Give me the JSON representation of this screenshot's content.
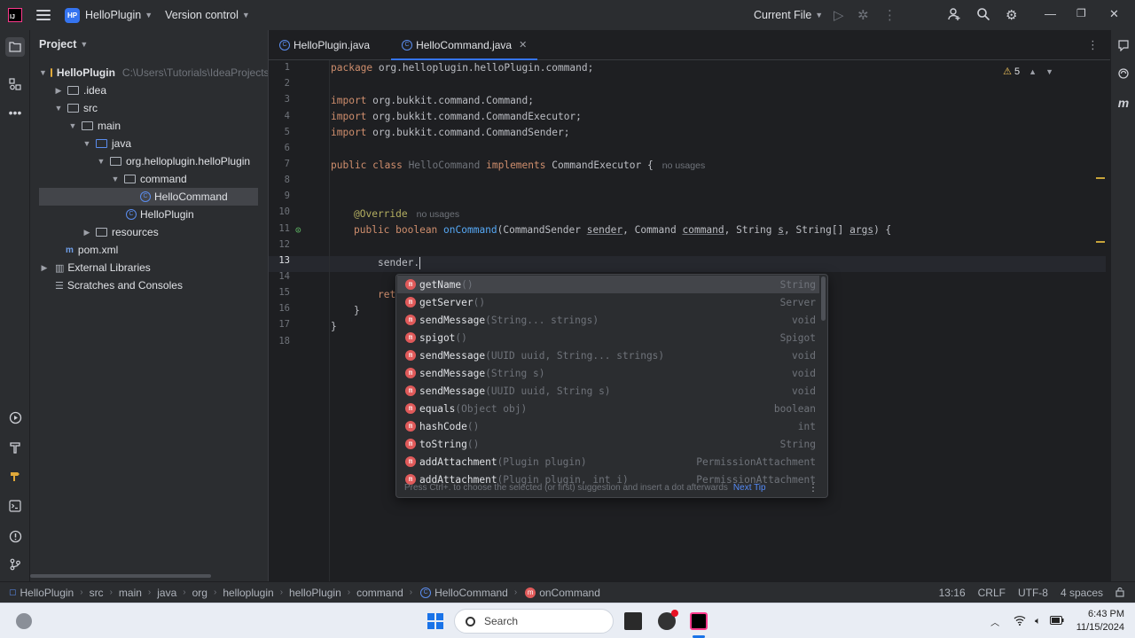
{
  "titlebar": {
    "project_badge": "HP",
    "project_name": "HelloPlugin",
    "vcs": "Version control",
    "run_config": "Current File"
  },
  "project_panel": {
    "title": "Project",
    "tree": [
      {
        "label": "HelloPlugin",
        "extra": "C:\\Users\\Tutorials\\IdeaProjects",
        "icon": "module-folder-icon",
        "expanded": true
      },
      {
        "label": ".idea",
        "icon": "folder-icon",
        "expanded": false
      },
      {
        "label": "src",
        "icon": "folder-icon",
        "expanded": true
      },
      {
        "label": "main",
        "icon": "folder-icon",
        "expanded": true
      },
      {
        "label": "java",
        "icon": "source-folder-icon",
        "expanded": true
      },
      {
        "label": "org.helloplugin.helloPlugin",
        "icon": "package-icon",
        "expanded": true
      },
      {
        "label": "command",
        "icon": "package-icon",
        "expanded": true
      },
      {
        "label": "HelloCommand",
        "icon": "class-icon",
        "selected": true
      },
      {
        "label": "HelloPlugin",
        "icon": "class-icon"
      },
      {
        "label": "resources",
        "icon": "resources-folder-icon",
        "expanded": false
      },
      {
        "label": "pom.xml",
        "icon": "maven-icon"
      },
      {
        "label": "External Libraries",
        "icon": "library-icon",
        "expanded": false
      },
      {
        "label": "Scratches and Consoles",
        "icon": "scratches-icon"
      }
    ]
  },
  "editor": {
    "tabs": [
      {
        "label": "HelloPlugin.java",
        "active": false
      },
      {
        "label": "HelloCommand.java",
        "active": true
      }
    ],
    "warnings_count": "5",
    "line_numbers": [
      "1",
      "2",
      "3",
      "4",
      "5",
      "6",
      "7",
      "8",
      "9",
      "10",
      "11",
      "12",
      "13",
      "14",
      "15",
      "16",
      "17",
      "18"
    ],
    "current_line": "13",
    "code": {
      "l1_kw": "package",
      "l1_rest": " org.helloplugin.helloPlugin.command;",
      "l3_kw": "import",
      "l3_rest": " org.bukkit.command.Command;",
      "l4_kw": "import",
      "l4_rest": " org.bukkit.command.CommandExecutor;",
      "l5_kw": "import",
      "l5_rest": " org.bukkit.command.CommandSender;",
      "l7_kw": "public class",
      "l7_name": " HelloCommand ",
      "l7_impl": "implements",
      "l7_rest": " CommandExecutor {",
      "l7_hint": "no usages",
      "l10_ann": "@Override",
      "l10_hint": "no usages",
      "l11_kw": "public boolean",
      "l11_fn": " onCommand",
      "l11_a": "(CommandSender ",
      "l11_p1": "sender",
      "l11_b": ", Command ",
      "l11_p2": "command",
      "l11_c": ", String ",
      "l11_p3": "s",
      "l11_d": ", String[] ",
      "l11_p4": "args",
      "l11_e": ") {",
      "l13": "sender.",
      "l15": "ret",
      "l16": "}",
      "l17": "}"
    }
  },
  "completion": {
    "items": [
      {
        "name": "getName",
        "sig": "()",
        "ret": "String"
      },
      {
        "name": "getServer",
        "sig": "()",
        "ret": "Server"
      },
      {
        "name": "sendMessage",
        "sig": "(String... strings)",
        "ret": "void"
      },
      {
        "name": "spigot",
        "sig": "()",
        "ret": "Spigot"
      },
      {
        "name": "sendMessage",
        "sig": "(UUID uuid, String... strings)",
        "ret": "void"
      },
      {
        "name": "sendMessage",
        "sig": "(String s)",
        "ret": "void"
      },
      {
        "name": "sendMessage",
        "sig": "(UUID uuid, String s)",
        "ret": "void"
      },
      {
        "name": "equals",
        "sig": "(Object obj)",
        "ret": "boolean"
      },
      {
        "name": "hashCode",
        "sig": "()",
        "ret": "int"
      },
      {
        "name": "toString",
        "sig": "()",
        "ret": "String"
      },
      {
        "name": "addAttachment",
        "sig": "(Plugin plugin)",
        "ret": "PermissionAttachment"
      },
      {
        "name": "addAttachment",
        "sig": "(Plugin plugin, int i)",
        "ret": "PermissionAttachment"
      }
    ],
    "footer_text": "Press Ctrl+. to choose the selected (or first) suggestion and insert a dot afterwards",
    "next_tip": "Next Tip"
  },
  "statusbar": {
    "breadcrumbs": [
      "HelloPlugin",
      "src",
      "main",
      "java",
      "org",
      "helloplugin",
      "helloPlugin",
      "command",
      "HelloCommand",
      "onCommand"
    ],
    "position": "13:16",
    "line_sep": "CRLF",
    "encoding": "UTF-8",
    "indent": "4 spaces"
  },
  "taskbar": {
    "search_placeholder": "Search",
    "time": "6:43 PM",
    "date": "11/15/2024"
  }
}
